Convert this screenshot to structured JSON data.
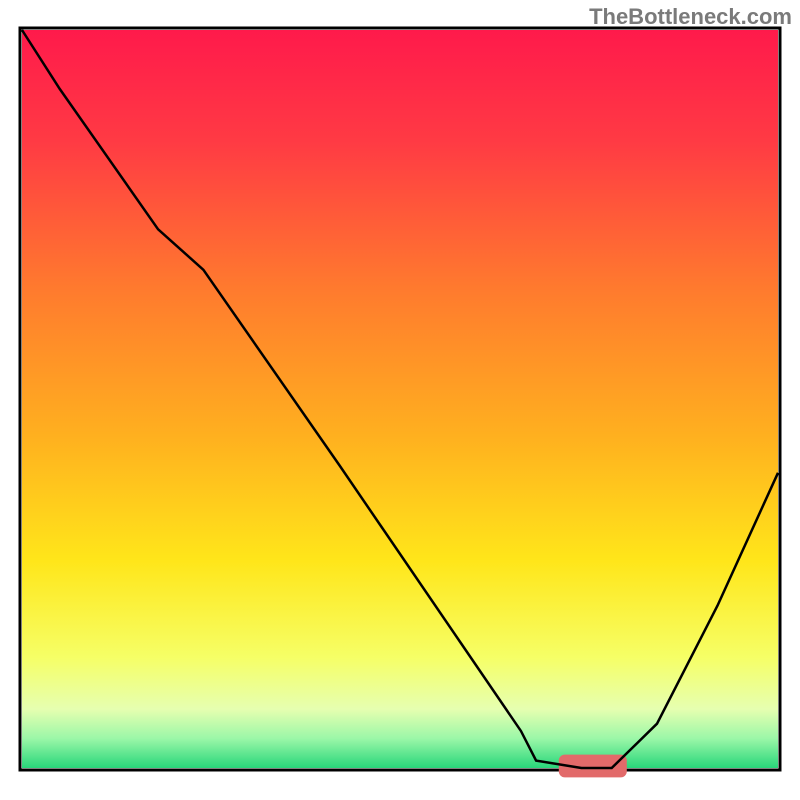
{
  "watermark": "TheBottleneck.com",
  "chart_data": {
    "type": "line",
    "title": "",
    "xlabel": "",
    "ylabel": "",
    "xlim": [
      0,
      100
    ],
    "ylim": [
      0,
      100
    ],
    "grid": false,
    "legend": false,
    "gradient_stops": [
      {
        "offset": 0.0,
        "color": "#ff1a4b"
      },
      {
        "offset": 0.15,
        "color": "#ff3a44"
      },
      {
        "offset": 0.35,
        "color": "#ff7a2e"
      },
      {
        "offset": 0.55,
        "color": "#ffb01f"
      },
      {
        "offset": 0.72,
        "color": "#ffe61a"
      },
      {
        "offset": 0.85,
        "color": "#f6ff66"
      },
      {
        "offset": 0.92,
        "color": "#e6ffb0"
      },
      {
        "offset": 0.96,
        "color": "#9bf7a8"
      },
      {
        "offset": 1.0,
        "color": "#28d67a"
      }
    ],
    "curve": {
      "x": [
        0,
        5,
        18,
        24,
        42,
        58,
        66,
        68,
        74,
        78,
        84,
        92,
        100
      ],
      "y": [
        100,
        92,
        73,
        67.5,
        41,
        17,
        5,
        1,
        0,
        0,
        6,
        22,
        40
      ]
    },
    "marker": {
      "x_start": 71,
      "x_end": 80,
      "y": 0,
      "color": "#e26a6a",
      "height": 2
    }
  }
}
